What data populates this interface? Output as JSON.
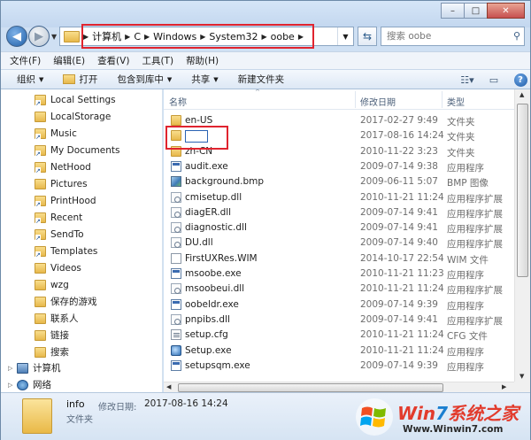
{
  "window": {
    "buttons": {
      "minimize": "–",
      "maximize": "□",
      "close": "✕"
    }
  },
  "address": {
    "crumbs": [
      "计算机",
      "C",
      "Windows",
      "System32",
      "oobe"
    ],
    "search_placeholder": "搜索 oobe"
  },
  "menu": [
    "文件(F)",
    "编辑(E)",
    "查看(V)",
    "工具(T)",
    "帮助(H)"
  ],
  "toolbar": {
    "organize": "组织",
    "open": "打开",
    "include_in_library": "包含到库中",
    "share": "共享",
    "new_folder": "新建文件夹"
  },
  "nav": {
    "items": [
      {
        "label": "Local Settings",
        "kind": "shortcut"
      },
      {
        "label": "LocalStorage",
        "kind": "folder"
      },
      {
        "label": "Music",
        "kind": "shortcut"
      },
      {
        "label": "My Documents",
        "kind": "shortcut"
      },
      {
        "label": "NetHood",
        "kind": "shortcut"
      },
      {
        "label": "Pictures",
        "kind": "folder"
      },
      {
        "label": "PrintHood",
        "kind": "shortcut"
      },
      {
        "label": "Recent",
        "kind": "shortcut"
      },
      {
        "label": "SendTo",
        "kind": "shortcut"
      },
      {
        "label": "Templates",
        "kind": "shortcut"
      },
      {
        "label": "Videos",
        "kind": "folder"
      },
      {
        "label": "wzg",
        "kind": "folder"
      },
      {
        "label": "保存的游戏",
        "kind": "folder"
      },
      {
        "label": "联系人",
        "kind": "folder"
      },
      {
        "label": "链接",
        "kind": "folder"
      },
      {
        "label": "搜索",
        "kind": "folder"
      }
    ],
    "computer": "计算机",
    "network": "网络"
  },
  "columns": {
    "name": "名称",
    "modified": "修改日期",
    "type": "类型"
  },
  "files": [
    {
      "name": "en-US",
      "date": "2017-02-27 9:49",
      "type": "文件夹",
      "icon": "folder"
    },
    {
      "name": "info",
      "date": "2017-08-16 14:24",
      "type": "文件夹",
      "icon": "folder",
      "selected": true
    },
    {
      "name": "zh-CN",
      "date": "2010-11-22 3:23",
      "type": "文件夹",
      "icon": "folder"
    },
    {
      "name": "audit.exe",
      "date": "2009-07-14 9:38",
      "type": "应用程序",
      "icon": "exe"
    },
    {
      "name": "background.bmp",
      "date": "2009-06-11 5:07",
      "type": "BMP 图像",
      "icon": "bmp"
    },
    {
      "name": "cmisetup.dll",
      "date": "2010-11-21 11:24",
      "type": "应用程序扩展",
      "icon": "dll"
    },
    {
      "name": "diagER.dll",
      "date": "2009-07-14 9:41",
      "type": "应用程序扩展",
      "icon": "dll"
    },
    {
      "name": "diagnostic.dll",
      "date": "2009-07-14 9:41",
      "type": "应用程序扩展",
      "icon": "dll"
    },
    {
      "name": "DU.dll",
      "date": "2009-07-14 9:40",
      "type": "应用程序扩展",
      "icon": "dll"
    },
    {
      "name": "FirstUXRes.WIM",
      "date": "2014-10-17 22:54",
      "type": "WIM 文件",
      "icon": "doc"
    },
    {
      "name": "msoobe.exe",
      "date": "2010-11-21 11:23",
      "type": "应用程序",
      "icon": "exe"
    },
    {
      "name": "msoobeui.dll",
      "date": "2010-11-21 11:24",
      "type": "应用程序扩展",
      "icon": "dll"
    },
    {
      "name": "oobeldr.exe",
      "date": "2009-07-14 9:39",
      "type": "应用程序",
      "icon": "exe"
    },
    {
      "name": "pnpibs.dll",
      "date": "2009-07-14 9:41",
      "type": "应用程序扩展",
      "icon": "dll"
    },
    {
      "name": "setup.cfg",
      "date": "2010-11-21 11:24",
      "type": "CFG 文件",
      "icon": "cfg"
    },
    {
      "name": "Setup.exe",
      "date": "2010-11-21 11:24",
      "type": "应用程序",
      "icon": "setup"
    },
    {
      "name": "setupsqm.exe",
      "date": "2009-07-14 9:39",
      "type": "应用程序",
      "icon": "exe"
    }
  ],
  "details": {
    "name": "info",
    "modified_label": "修改日期:",
    "modified_value": "2017-08-16 14:24",
    "type": "文件夹"
  },
  "watermark": {
    "brand_red": "Win",
    "brand_num": "7",
    "brand_rest": "系统之家",
    "url": "Www.Winwin7.com"
  }
}
